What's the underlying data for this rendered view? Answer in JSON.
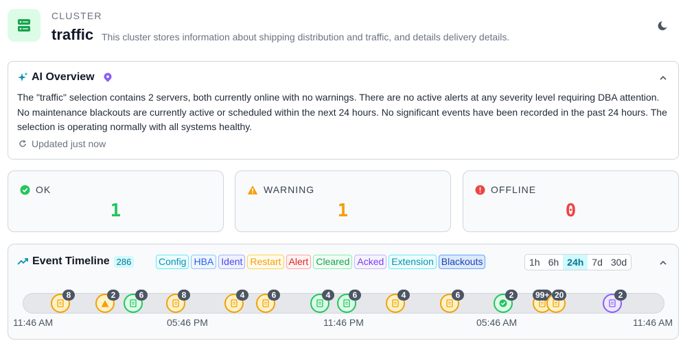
{
  "header": {
    "kicker": "CLUSTER",
    "title": "traffic",
    "description": "This cluster stores information about shipping distribution and traffic, and details delivery details.",
    "icon": "server-icon",
    "accent": "#16a34a"
  },
  "ai": {
    "title": "AI Overview",
    "text": "The \"traffic\" selection contains 2 servers, both currently online with no warnings. There are no active alerts at any severity level requiring DBA attention. No maintenance blackouts are currently active or scheduled within the next 24 hours. No significant events have been recorded in the past 24 hours. The selection is operating normally with all systems healthy.",
    "updated": "Updated just now"
  },
  "stats": [
    {
      "label": "OK",
      "value": "1",
      "color": "#22c55e",
      "icon": "check-circle-icon"
    },
    {
      "label": "WARNING",
      "value": "1",
      "color": "#f59e0b",
      "icon": "warning-triangle-icon"
    },
    {
      "label": "OFFLINE",
      "value": "0",
      "color": "#ef4444",
      "icon": "alert-circle-icon"
    }
  ],
  "timeline": {
    "title": "Event Timeline",
    "count": "286",
    "filters": [
      "Config",
      "HBA",
      "Ident",
      "Restart",
      "Alert",
      "Cleared",
      "Acked",
      "Extension",
      "Blackouts"
    ],
    "ranges": [
      "1h",
      "6h",
      "24h",
      "7d",
      "30d"
    ],
    "active_range": "24h",
    "ticks": [
      "11:46 AM",
      "05:46 PM",
      "11:46 PM",
      "05:46 AM",
      "11:46 AM"
    ],
    "markers": [
      {
        "count": "8",
        "kind": "config"
      },
      {
        "count": "2",
        "kind": "warning"
      },
      {
        "count": "6",
        "kind": "cleared"
      },
      {
        "count": "8",
        "kind": "config"
      },
      {
        "count": "4",
        "kind": "config"
      },
      {
        "count": "6",
        "kind": "config"
      },
      {
        "count": "4",
        "kind": "cleared"
      },
      {
        "count": "6",
        "kind": "cleared"
      },
      {
        "count": "4",
        "kind": "config"
      },
      {
        "count": "6",
        "kind": "config"
      },
      {
        "count": "2",
        "kind": "ok"
      },
      {
        "count": "99+",
        "kind": "config"
      },
      {
        "count": "20",
        "kind": "config"
      },
      {
        "count": "2",
        "kind": "acked"
      }
    ]
  }
}
